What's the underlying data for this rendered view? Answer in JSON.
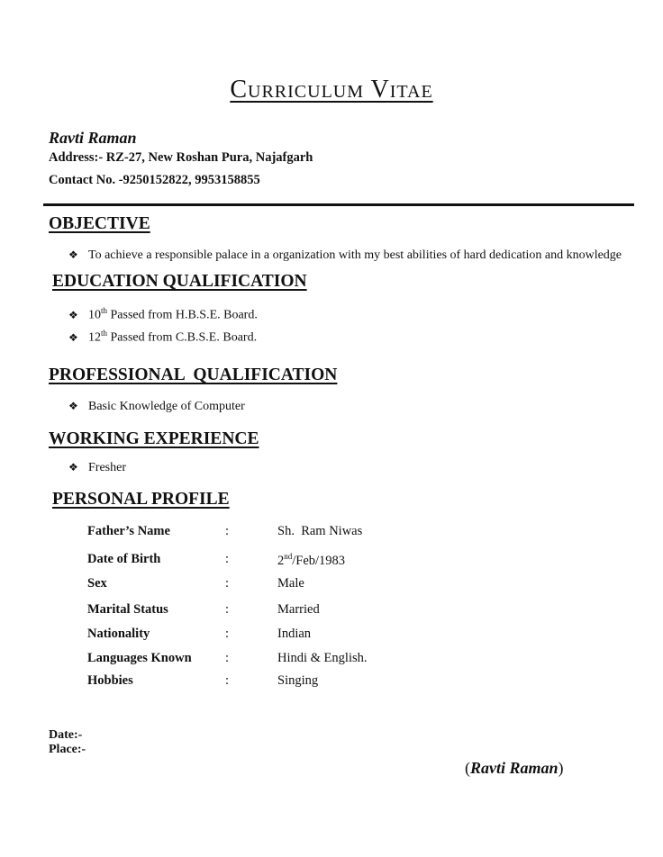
{
  "title": "Curriculum Vitae",
  "header": {
    "name": "Ravti Raman",
    "address": "Address:- RZ-27, New Roshan Pura, Najafgarh",
    "contact": "Contact No. -9250152822, 9953158855"
  },
  "bullet_icon": "diamond-bullet-icon",
  "sections": {
    "objective": {
      "heading": "OBJECTIVE",
      "items": [
        "To achieve a responsible palace in a organization with my best abilities of hard dedication and knowledge"
      ]
    },
    "education": {
      "heading": "EDUCATION QUALIFICATION",
      "items": [
        {
          "num": "10",
          "sup": "th",
          "text": " Passed from H.B.S.E. Board."
        },
        {
          "num": "12",
          "sup": "th",
          "text": " Passed from C.B.S.E. Board."
        }
      ]
    },
    "professional": {
      "heading": "PROFESSIONAL  QUALIFICATION",
      "items": [
        "Basic Knowledge of Computer"
      ]
    },
    "experience": {
      "heading": "WORKING EXPERIENCE",
      "items": [
        "Fresher"
      ]
    },
    "personal": {
      "heading": "PERSONAL PROFILE",
      "separator": ":",
      "rows": [
        {
          "label": "Father’s Name",
          "value": "Sh.  Ram Niwas"
        },
        {
          "label": "Date of Birth",
          "value_num": "2",
          "value_sup": "nd",
          "value_rest": "/Feb/1983"
        },
        {
          "label": "Sex",
          "value": "Male"
        },
        {
          "label": "Marital Status",
          "value": "Married"
        },
        {
          "label": "Nationality",
          "value": "Indian"
        },
        {
          "label": "Languages Known",
          "value": "Hindi & English."
        },
        {
          "label": "Hobbies",
          "value": "Singing"
        }
      ]
    }
  },
  "footer": {
    "date_label": "Date:-",
    "place_label": "Place:-",
    "signature_open": "(",
    "signature_name": "Ravti Raman",
    "signature_close": ")"
  }
}
